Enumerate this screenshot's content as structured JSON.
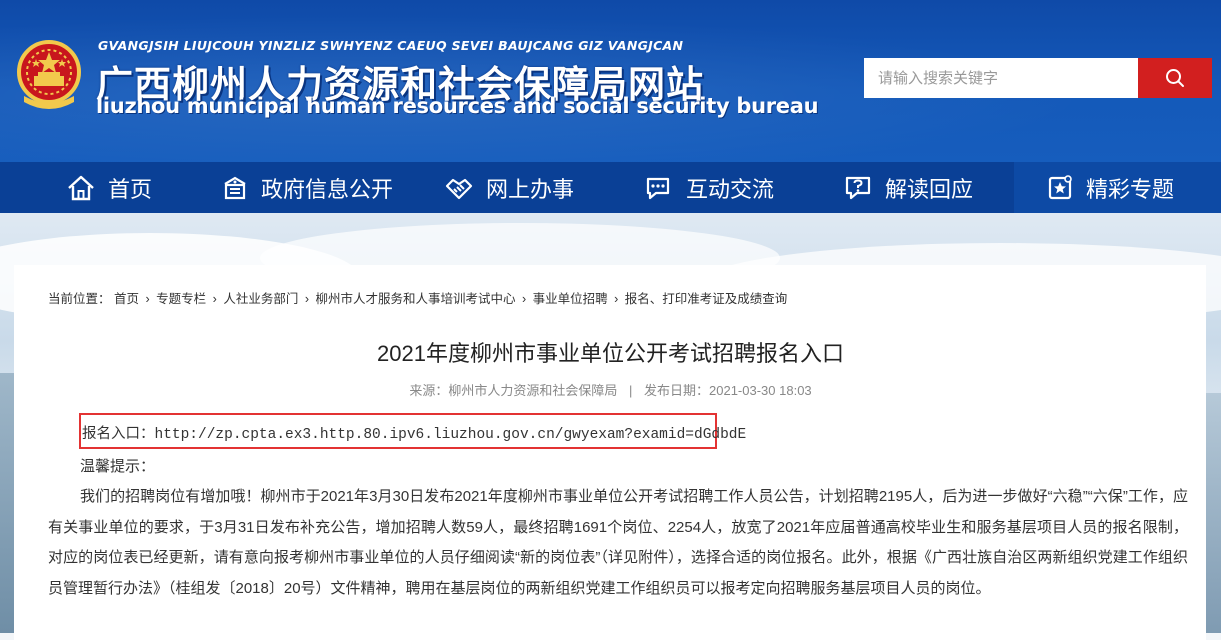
{
  "header": {
    "site_en_top": "GVANGJSIH LIUJCOUH YINZLIZ SWHYENZ CAEUQ SEVEI BAUJCANG GIZ VANGJCAN",
    "site_cn": "广西柳州人力资源和社会保障局网站",
    "site_en": "liuzhou municipal human resources and social security bureau"
  },
  "search": {
    "placeholder": "请输入搜索关键字",
    "icon": "search-icon"
  },
  "nav": {
    "items": [
      {
        "label": "首页",
        "icon": "home-icon"
      },
      {
        "label": "政府信息公开",
        "icon": "building-icon"
      },
      {
        "label": "网上办事",
        "icon": "handshake-icon"
      },
      {
        "label": "互动交流",
        "icon": "chat-icon"
      },
      {
        "label": "解读回应",
        "icon": "question-bubble-icon"
      },
      {
        "label": "精彩专题",
        "icon": "star-icon"
      }
    ]
  },
  "breadcrumb": {
    "prefix": "当前位置：",
    "items": [
      "首页",
      "专题专栏",
      "人社业务部门",
      "柳州市人才服务和人事培训考试中心",
      "事业单位招聘",
      "报名、打印准考证及成绩查询"
    ],
    "separator": "›"
  },
  "article": {
    "title": "2021年度柳州市事业单位公开考试招聘报名入口",
    "source_label": "来源：",
    "source": "柳州市人力资源和社会保障局",
    "date_label": "发布日期：",
    "date": "2021-03-30 18:03",
    "entry_label": "报名入口：",
    "entry_url": "http://zp.cpta.ex3.http.80.ipv6.liuzhou.gov.cn/gwyexam?examid=dGdbdE",
    "tip": "温馨提示：",
    "paragraph": "我们的招聘岗位有增加哦！柳州市于2021年3月30日发布2021年度柳州市事业单位公开考试招聘工作人员公告，计划招聘2195人，后为进一步做好“六稳”“六保”工作，应有关事业单位的要求，于3月31日发布补充公告，增加招聘人数59人，最终招聘1691个岗位、2254人，放宽了2021年应届普通高校毕业生和服务基层项目人员的报名限制，对应的岗位表已经更新，请有意向报考柳州市事业单位的人员仔细阅读“新的岗位表”（详见附件），选择合适的岗位报名。此外，根据《广西壮族自治区两新组织党建工作组织员管理暂行办法》（桂组发〔2018〕20号）文件精神，聘用在基层岗位的两新组织党建工作组织员可以报考定向招聘服务基层项目人员的岗位。"
  },
  "colors": {
    "header_blue": "#1459b9",
    "nav_blue": "#0a4096",
    "search_red": "#d21f1f",
    "highlight_red": "#e33333"
  }
}
